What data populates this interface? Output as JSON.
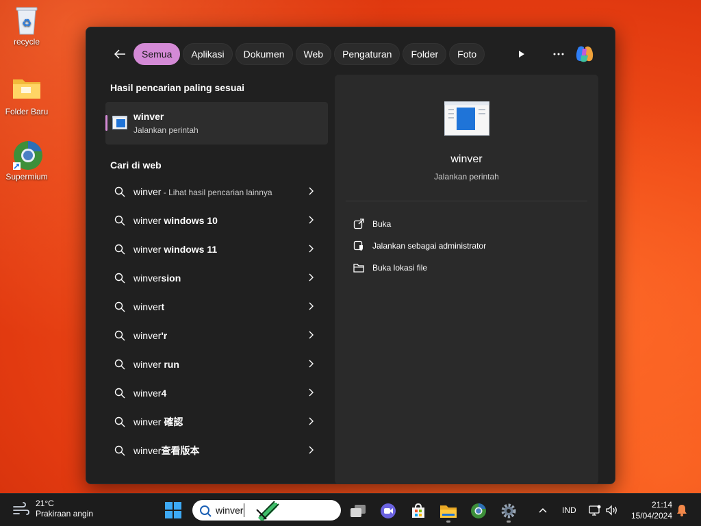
{
  "desktop": {
    "icons": [
      {
        "label": "recycle",
        "icon": "recycle-bin-icon"
      },
      {
        "label": "Folder Baru",
        "icon": "folder-icon"
      },
      {
        "label": "Supermium",
        "icon": "supermium-browser-icon"
      }
    ]
  },
  "search_panel": {
    "filters": [
      "Semua",
      "Aplikasi",
      "Dokumen",
      "Web",
      "Pengaturan",
      "Folder",
      "Foto"
    ],
    "active_filter": "Semua",
    "best_match": {
      "section_title": "Hasil pencarian paling sesuai",
      "title": "winver",
      "subtitle": "Jalankan perintah"
    },
    "web": {
      "section_title": "Cari di web",
      "items": [
        {
          "prefix": "winver",
          "bold": "",
          "suffix": " - Lihat hasil pencarian lainnya"
        },
        {
          "prefix": "winver ",
          "bold": "windows 10",
          "suffix": ""
        },
        {
          "prefix": "winver ",
          "bold": "windows 11",
          "suffix": ""
        },
        {
          "prefix": "winver",
          "bold": "sion",
          "suffix": ""
        },
        {
          "prefix": "winver",
          "bold": "t",
          "suffix": ""
        },
        {
          "prefix": "winver",
          "bold": "'r",
          "suffix": ""
        },
        {
          "prefix": "winver ",
          "bold": "run",
          "suffix": ""
        },
        {
          "prefix": "winver",
          "bold": "4",
          "suffix": ""
        },
        {
          "prefix": "winver ",
          "bold": "確認",
          "suffix": ""
        },
        {
          "prefix": "winver",
          "bold": "查看版本",
          "suffix": ""
        }
      ]
    },
    "detail": {
      "title": "winver",
      "subtitle": "Jalankan perintah",
      "actions": [
        {
          "label": "Buka",
          "icon": "open-external-icon"
        },
        {
          "label": "Jalankan sebagai administrator",
          "icon": "admin-shield-icon"
        },
        {
          "label": "Buka lokasi file",
          "icon": "folder-open-icon"
        }
      ]
    }
  },
  "taskbar": {
    "weather_temp": "21°C",
    "weather_desc": "Prakiraan angin",
    "search_value": "winver",
    "tray_language": "IND",
    "time": "21:14",
    "date": "15/04/2024"
  },
  "colors": {
    "accent": "#d48ad6",
    "panel_bg": "#202020",
    "detail_bg": "#2a2a2a",
    "taskbar_bg": "#1c1c1c",
    "wallpaper": "#e8461a"
  }
}
